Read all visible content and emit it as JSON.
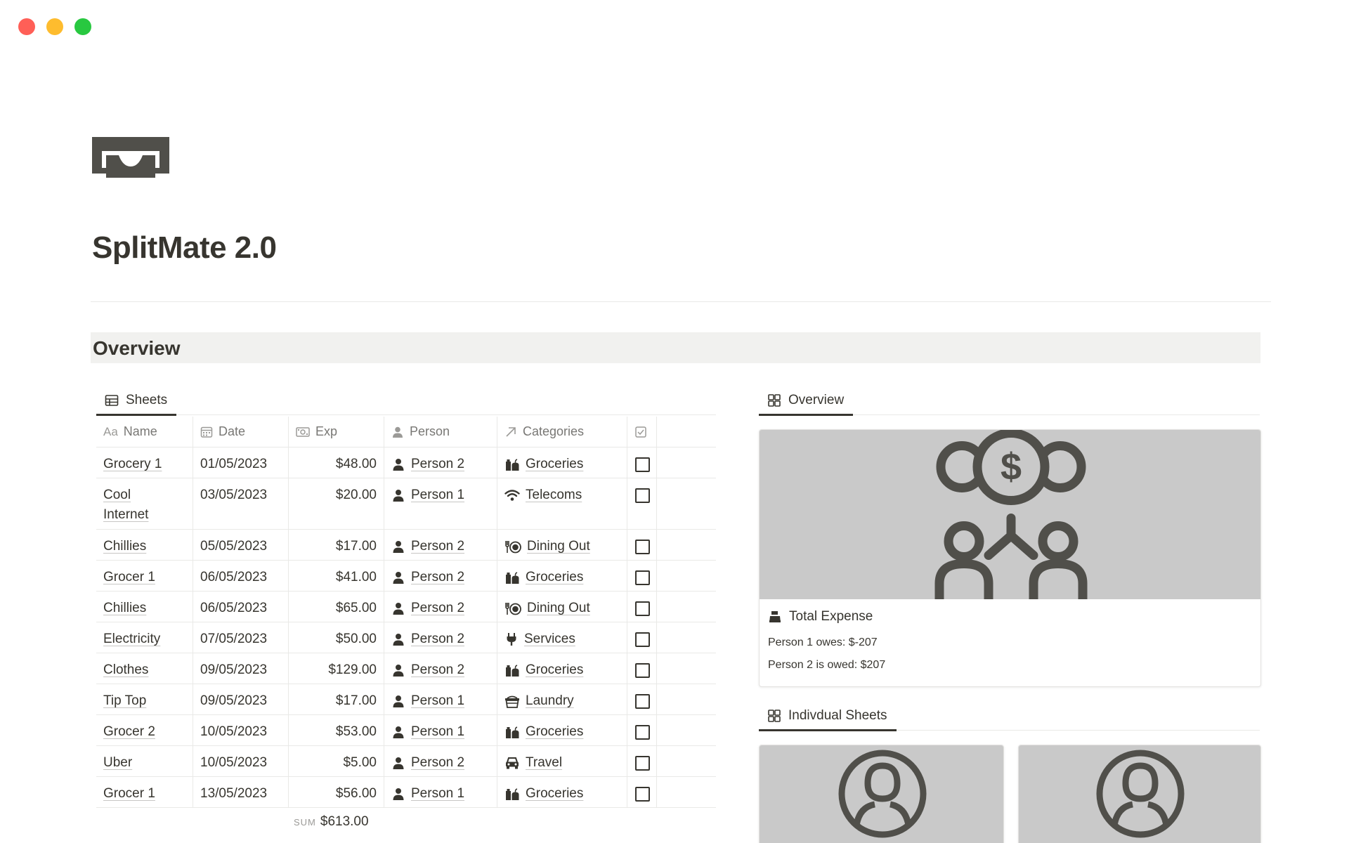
{
  "window": {
    "colors": [
      "#ff5f57",
      "#febc2e",
      "#28c840"
    ]
  },
  "page": {
    "icon": "money-bill-icon",
    "title": "SplitMate 2.0"
  },
  "section": {
    "title": "Overview"
  },
  "sheets_view": {
    "tab_label": "Sheets",
    "columns": [
      {
        "label": "Name",
        "prefix": "Aa"
      },
      {
        "label": "Date",
        "icon": "calendar-icon"
      },
      {
        "label": "Exp",
        "icon": "money-icon"
      },
      {
        "label": "Person",
        "icon": "person-icon"
      },
      {
        "label": "Categories",
        "icon": "relation-arrow-icon"
      },
      {
        "label": "",
        "icon": "checkbox-icon"
      }
    ],
    "rows": [
      {
        "name": "Grocery 1",
        "date": "01/05/2023",
        "exp": "$48.00",
        "person": "Person 2",
        "category": "Groceries",
        "cat_icon": "groceries"
      },
      {
        "name": "Cool Internet",
        "date": "03/05/2023",
        "exp": "$20.00",
        "person": "Person 1",
        "category": "Telecoms",
        "cat_icon": "wifi"
      },
      {
        "name": "Chillies",
        "date": "05/05/2023",
        "exp": "$17.00",
        "person": "Person 2",
        "category": "Dining Out",
        "cat_icon": "dining"
      },
      {
        "name": "Grocer 1",
        "date": "06/05/2023",
        "exp": "$41.00",
        "person": "Person 2",
        "category": "Groceries",
        "cat_icon": "groceries"
      },
      {
        "name": "Chillies",
        "date": "06/05/2023",
        "exp": "$65.00",
        "person": "Person 2",
        "category": "Dining Out",
        "cat_icon": "dining"
      },
      {
        "name": "Electricity",
        "date": "07/05/2023",
        "exp": "$50.00",
        "person": "Person 2",
        "category": "Services",
        "cat_icon": "plug"
      },
      {
        "name": "Clothes",
        "date": "09/05/2023",
        "exp": "$129.00",
        "person": "Person 2",
        "category": "Groceries",
        "cat_icon": "groceries"
      },
      {
        "name": "Tip Top",
        "date": "09/05/2023",
        "exp": "$17.00",
        "person": "Person 1",
        "category": "Laundry",
        "cat_icon": "basket"
      },
      {
        "name": "Grocer 2",
        "date": "10/05/2023",
        "exp": "$53.00",
        "person": "Person 1",
        "category": "Groceries",
        "cat_icon": "groceries"
      },
      {
        "name": "Uber",
        "date": "10/05/2023",
        "exp": "$5.00",
        "person": "Person 2",
        "category": "Travel",
        "cat_icon": "car"
      },
      {
        "name": "Grocer 1",
        "date": "13/05/2023",
        "exp": "$56.00",
        "person": "Person 1",
        "category": "Groceries",
        "cat_icon": "groceries"
      }
    ],
    "sum_label": "SUM",
    "sum_value": "$613.00"
  },
  "overview_view": {
    "tab_label": "Overview",
    "card": {
      "cover_icon": "split-money-icon",
      "title": "Total Expense",
      "title_icon": "cash-register-icon",
      "line1": "Person 1 owes: $-207",
      "line2": "Person 2 is owed: $207"
    }
  },
  "individual_view": {
    "tab_label": "Indivdual Sheets",
    "cards": [
      {
        "cover_icon": "user-circle-icon"
      },
      {
        "cover_icon": "user-circle-icon"
      }
    ]
  }
}
